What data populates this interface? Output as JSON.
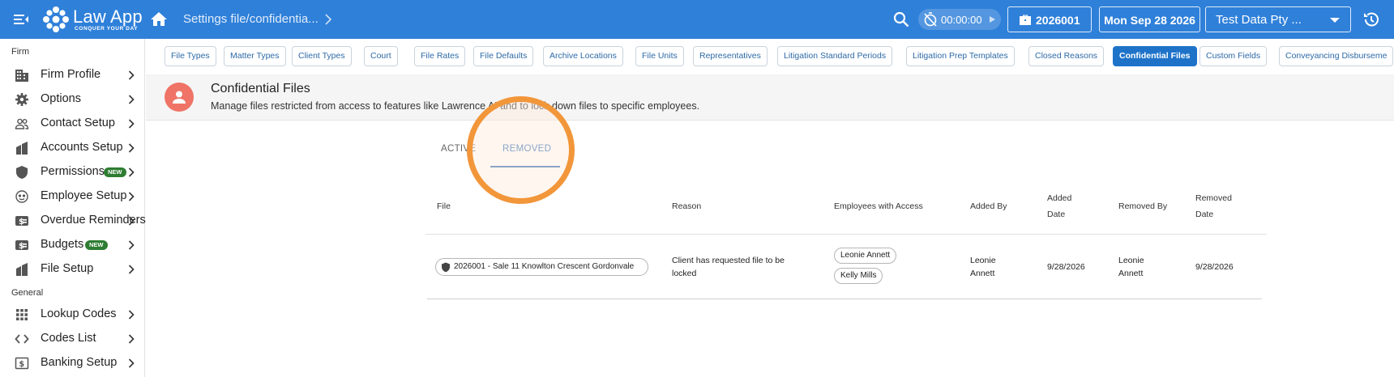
{
  "app": {
    "name": "Law App",
    "tagline": "CONQUER YOUR DAY"
  },
  "header": {
    "breadcrumb": "Settings file/confidentia...",
    "timer": "00:00:00",
    "file_number": "2026001",
    "date": "Mon Sep 28 2026",
    "company": "Test Data Pty ..."
  },
  "sidebar": {
    "section_firm": "Firm",
    "section_general": "General",
    "items": [
      {
        "label": "Firm Profile",
        "icon": "building-icon"
      },
      {
        "label": "Options",
        "icon": "gear-icon"
      },
      {
        "label": "Contact Setup",
        "icon": "people-icon"
      },
      {
        "label": "Accounts Setup",
        "icon": "accounts-icon"
      },
      {
        "label": "Permissions",
        "icon": "shield-icon",
        "badge": "NEW"
      },
      {
        "label": "Employee Setup",
        "icon": "face-icon"
      },
      {
        "label": "Overdue Reminders",
        "icon": "dollar-icon"
      },
      {
        "label": "Budgets",
        "icon": "dollar-icon",
        "badge": "NEW"
      },
      {
        "label": "File Setup",
        "icon": "accounts-icon"
      },
      {
        "label": "Lookup Codes",
        "icon": "grid-icon"
      },
      {
        "label": "Codes List",
        "icon": "code-icon"
      },
      {
        "label": "Banking Setup",
        "icon": "bank-icon"
      }
    ]
  },
  "settings_tabs": [
    "File Types",
    "Matter Types",
    "Client Types",
    "Court",
    "File Rates",
    "File Defaults",
    "Archive Locations",
    "File Units",
    "Representatives",
    "Litigation Standard Periods",
    "Litigation Prep Templates",
    "Closed Reasons",
    "Confidential Files",
    "Custom Fields",
    "Conveyancing Disburseme"
  ],
  "active_settings_tab": "Confidential Files",
  "page": {
    "title": "Confidential Files",
    "description": "Manage files restricted from access to features like Lawrence AI and to lock down files to specific employees."
  },
  "content_tabs": {
    "active": "ACTIVE",
    "removed": "REMOVED",
    "selected": "REMOVED"
  },
  "table": {
    "headers": {
      "file": "File",
      "reason": "Reason",
      "employees": "Employees with Access",
      "added_by": "Added By",
      "added_date_1": "Added",
      "added_date_2": "Date",
      "removed_by": "Removed By",
      "removed_date_1": "Removed",
      "removed_date_2": "Date"
    },
    "rows": [
      {
        "file": "2026001 - Sale 11 Knowlton Crescent Gordonvale",
        "reason_1": "Client has requested file to be",
        "reason_2": "locked",
        "employees": [
          "Leonie Annett",
          "Kelly Mills"
        ],
        "added_by_1": "Leonie",
        "added_by_2": "Annett",
        "added_date": "9/28/2026",
        "removed_by_1": "Leonie",
        "removed_by_2": "Annett",
        "removed_date": "9/28/2026"
      }
    ]
  },
  "colors": {
    "header_bg": "#2f80d9",
    "active_tab": "#1e73c9",
    "avatar": "#ef7366",
    "highlight": "#f2963a",
    "badge_new": "#2e7d32"
  }
}
